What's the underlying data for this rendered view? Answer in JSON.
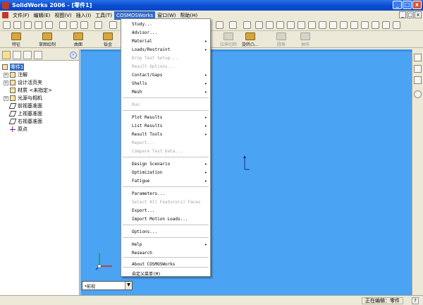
{
  "window": {
    "title": "SolidWorks 2006 - [零件1]",
    "buttons": [
      "_",
      "□",
      "x"
    ]
  },
  "menubar": {
    "items": [
      "文件(F)",
      "编辑(E)",
      "视图(V)",
      "插入(I)",
      "工具(T)",
      "COSMOSWorks",
      "窗口(W)",
      "帮助(H)"
    ],
    "active": "COSMOSWorks",
    "mdi_buttons": [
      "_",
      "□",
      "x"
    ]
  },
  "command_manager": {
    "items": [
      "特征",
      "草图绘制",
      "曲面",
      "钣金"
    ],
    "disabled_items": [
      "拉伸切除",
      "旋转凸...",
      "圆角",
      "抽壳"
    ]
  },
  "feature_tree": {
    "collapse_symbol": "»",
    "rows": [
      {
        "label": "零件1",
        "selected": true
      },
      {
        "label": "注解",
        "expand": "+"
      },
      {
        "label": "设计活页夹",
        "expand": "+"
      },
      {
        "label": "材质 <未指定>"
      },
      {
        "label": "光源与相机",
        "expand": "+"
      },
      {
        "label": "前视基准面"
      },
      {
        "label": "上视基准面"
      },
      {
        "label": "右视基准面"
      },
      {
        "label": "原点"
      }
    ]
  },
  "configuration": {
    "value": "*前视"
  },
  "status_bar": {
    "text": "正在编辑：零件",
    "help": "?"
  },
  "cosmos_menu": {
    "items": [
      {
        "label": "Study...",
        "enabled": true,
        "submenu": false
      },
      {
        "label": "Advisor...",
        "enabled": true,
        "submenu": false
      },
      {
        "label": "Material",
        "enabled": true,
        "submenu": true
      },
      {
        "label": "Loads/Restraint",
        "enabled": true,
        "submenu": true
      },
      {
        "label": "Drop Test Setup...",
        "enabled": false,
        "submenu": false
      },
      {
        "label": "Result Options...",
        "enabled": false,
        "submenu": false
      },
      {
        "label": "Contact/Gaps",
        "enabled": true,
        "submenu": true
      },
      {
        "label": "Shells",
        "enabled": true,
        "submenu": true
      },
      {
        "label": "Mesh",
        "enabled": true,
        "submenu": true
      },
      {
        "label": "Run",
        "enabled": false,
        "submenu": false
      },
      {
        "label": "Plot Results",
        "enabled": true,
        "submenu": true
      },
      {
        "label": "List Results",
        "enabled": true,
        "submenu": true
      },
      {
        "label": "Result Tools",
        "enabled": true,
        "submenu": true
      },
      {
        "label": "Report...",
        "enabled": false,
        "submenu": false
      },
      {
        "label": "Compare Test Data...",
        "enabled": false,
        "submenu": false
      },
      {
        "label": "Design Scenario",
        "enabled": true,
        "submenu": true
      },
      {
        "label": "Optimization",
        "enabled": true,
        "submenu": true
      },
      {
        "label": "Fatigue",
        "enabled": true,
        "submenu": true
      },
      {
        "label": "Parameters...",
        "enabled": true,
        "submenu": false
      },
      {
        "label": "Select All Feature(s) Faces",
        "enabled": false,
        "submenu": false
      },
      {
        "label": "Export...",
        "enabled": true,
        "submenu": false
      },
      {
        "label": "Import Motion Loads...",
        "enabled": true,
        "submenu": false
      },
      {
        "label": "Options...",
        "enabled": true,
        "submenu": false
      },
      {
        "label": "Help",
        "enabled": true,
        "submenu": true
      },
      {
        "label": "Research",
        "enabled": true,
        "submenu": false
      },
      {
        "label": "About COSMOSWorks",
        "enabled": true,
        "submenu": false
      },
      {
        "label": "自定义菜单(M)",
        "enabled": true,
        "submenu": false
      }
    ],
    "submenu_arrow": "▸"
  },
  "colors": {
    "viewport": "#4aa3f3",
    "title_bar": "#0a4fd2",
    "menu_highlight": "#316ac5"
  }
}
